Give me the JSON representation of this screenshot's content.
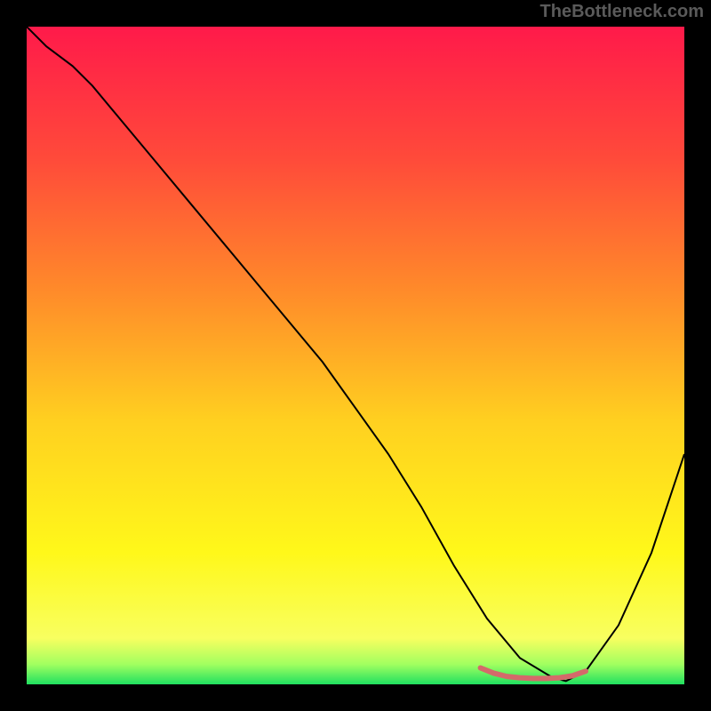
{
  "attribution": "TheBottleneck.com",
  "chart_data": {
    "type": "line",
    "title": "",
    "xlabel": "",
    "ylabel": "",
    "xlim": [
      0,
      100
    ],
    "ylim": [
      0,
      100
    ],
    "gradient_stops": [
      {
        "offset": 0,
        "color": "#ff1a4a"
      },
      {
        "offset": 20,
        "color": "#ff4a3a"
      },
      {
        "offset": 40,
        "color": "#ff8a2a"
      },
      {
        "offset": 60,
        "color": "#ffd020"
      },
      {
        "offset": 80,
        "color": "#fff81a"
      },
      {
        "offset": 93,
        "color": "#f8ff60"
      },
      {
        "offset": 97,
        "color": "#a0ff60"
      },
      {
        "offset": 100,
        "color": "#20e060"
      }
    ],
    "series": [
      {
        "name": "bottleneck-curve",
        "stroke": "#000000",
        "x": [
          0,
          3,
          7,
          10,
          15,
          20,
          25,
          30,
          35,
          40,
          45,
          50,
          55,
          60,
          65,
          70,
          75,
          80,
          82,
          85,
          90,
          95,
          100
        ],
        "values": [
          100,
          97,
          94,
          91,
          85,
          79,
          73,
          67,
          61,
          55,
          49,
          42,
          35,
          27,
          18,
          10,
          4,
          1,
          0.5,
          2,
          9,
          20,
          35
        ]
      },
      {
        "name": "optimal-band",
        "stroke": "#d46a6a",
        "x": [
          69,
          71,
          73,
          75,
          77,
          79,
          81,
          83,
          85
        ],
        "values": [
          2.5,
          1.7,
          1.2,
          1.0,
          0.9,
          0.9,
          1.0,
          1.3,
          2.0
        ]
      }
    ]
  }
}
